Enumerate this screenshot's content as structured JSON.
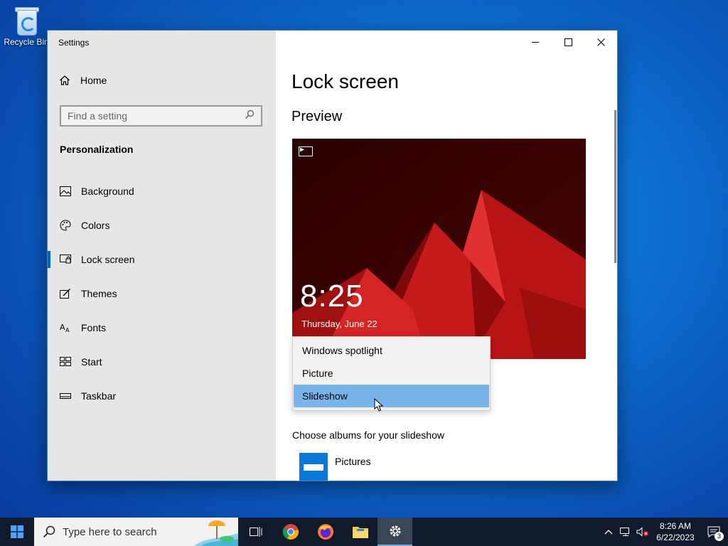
{
  "desktop": {
    "recycle_bin_label": "Recycle Bin"
  },
  "window": {
    "app_title": "Settings",
    "nav": {
      "home_label": "Home",
      "search_placeholder": "Find a setting",
      "section_title": "Personalization",
      "items": [
        {
          "label": "Background",
          "icon": "background-icon"
        },
        {
          "label": "Colors",
          "icon": "palette-icon"
        },
        {
          "label": "Lock screen",
          "icon": "lock-screen-icon",
          "active": true
        },
        {
          "label": "Themes",
          "icon": "themes-icon"
        },
        {
          "label": "Fonts",
          "icon": "fonts-icon"
        },
        {
          "label": "Start",
          "icon": "start-icon"
        },
        {
          "label": "Taskbar",
          "icon": "taskbar-icon"
        }
      ]
    },
    "content": {
      "page_title": "Lock screen",
      "preview_title": "Preview",
      "preview_time": "8:25",
      "preview_date": "Thursday, June 22",
      "background_dropdown": {
        "options": [
          "Windows spotlight",
          "Picture",
          "Slideshow"
        ],
        "selected": "Slideshow"
      },
      "albums_label": "Choose albums for your slideshow",
      "album_name": "Pictures"
    }
  },
  "taskbar": {
    "search_placeholder": "Type here to search",
    "time": "8:26 AM",
    "date": "6/22/2023",
    "notification_count": "3",
    "apps": [
      "task-view-icon",
      "chrome-icon",
      "firefox-icon",
      "file-explorer-icon",
      "settings-icon"
    ]
  },
  "colors": {
    "accent": "#0067c0",
    "selected_option": "#79b4ea",
    "nav_background": "#e6e6e6",
    "taskbar": "#101a2b"
  }
}
